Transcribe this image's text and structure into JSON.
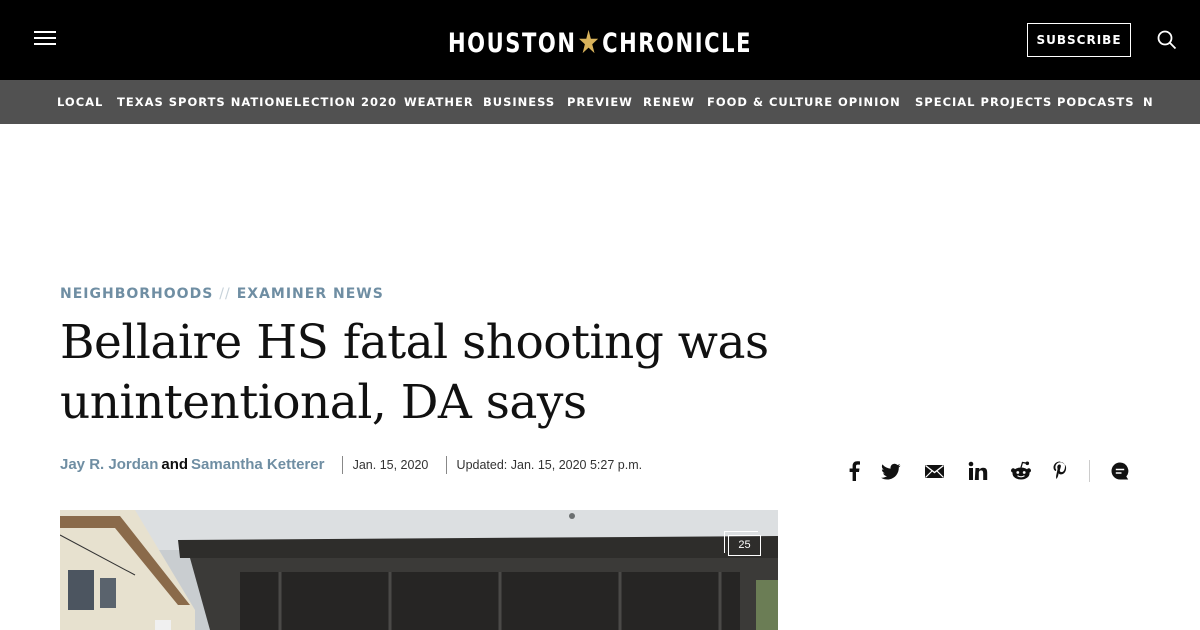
{
  "header": {
    "logo_left": "HOUSTON",
    "logo_star": "★",
    "logo_right": "CHRONICLE",
    "subscribe_label": "SUBSCRIBE"
  },
  "nav": {
    "items": [
      "LOCAL",
      "TEXAS SPORTS NATION",
      "ELECTION 2020",
      "WEATHER",
      "BUSINESS",
      "PREVIEW",
      "RENEW",
      "FOOD & CULTURE",
      "OPINION",
      "SPECIAL PROJECTS",
      "PODCASTS",
      "N"
    ]
  },
  "article": {
    "section": "NEIGHBORHOODS",
    "section_sep": "//",
    "subsection": "EXAMINER NEWS",
    "headline": "Bellaire HS fatal shooting was unintentional, DA says",
    "author_1": "Jay R. Jordan",
    "author_joiner": "and",
    "author_2": "Samantha Ketterer",
    "published": "Jan. 15, 2020",
    "updated": "Updated: Jan. 15, 2020 5:27 p.m.",
    "gallery_count": "25"
  },
  "share_icons": [
    "facebook-icon",
    "twitter-icon",
    "email-icon",
    "linkedin-icon",
    "reddit-icon",
    "pinterest-icon",
    "comments-icon"
  ]
}
